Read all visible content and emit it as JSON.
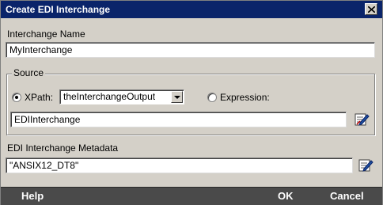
{
  "window": {
    "title": "Create EDI Interchange"
  },
  "interchange_name": {
    "label": "Interchange Name",
    "value": "MyInterchange"
  },
  "source": {
    "group_title": "Source",
    "xpath": {
      "label": "XPath:",
      "selected": true,
      "dropdown_value": "theInterchangeOutput"
    },
    "expression": {
      "label": "Expression:",
      "selected": false
    },
    "value": "EDIInterchange"
  },
  "metadata": {
    "label": "EDI Interchange Metadata",
    "value": "\"ANSIX12_DT8\""
  },
  "footer": {
    "help_label": "Help",
    "ok_label": "OK",
    "cancel_label": "Cancel"
  },
  "icons": {
    "close": "close-icon",
    "edit": "edit-pencil-icon",
    "dropdown": "chevron-down-icon"
  }
}
